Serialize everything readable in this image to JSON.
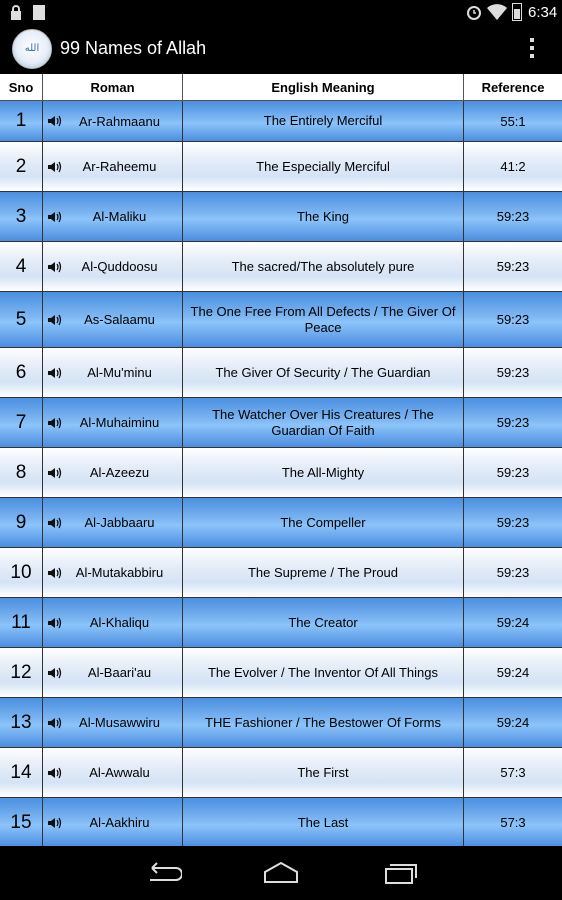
{
  "status_bar": {
    "time": "6:34"
  },
  "app": {
    "title": "99 Names of Allah",
    "icon_text": "الله"
  },
  "table": {
    "headers": {
      "sno": "Sno",
      "roman": "Roman",
      "meaning": "English Meaning",
      "reference": "Reference"
    },
    "rows": [
      {
        "sno": "1",
        "roman": "Ar-Rahmaanu",
        "meaning": "The Entirely Merciful",
        "reference": "55:1"
      },
      {
        "sno": "2",
        "roman": "Ar-Raheemu",
        "meaning": "The Especially Merciful",
        "reference": "41:2"
      },
      {
        "sno": "3",
        "roman": "Al-Maliku",
        "meaning": "The King",
        "reference": "59:23"
      },
      {
        "sno": "4",
        "roman": "Al-Quddoosu",
        "meaning": "The sacred/The absolutely pure",
        "reference": "59:23"
      },
      {
        "sno": "5",
        "roman": "As-Salaamu",
        "meaning": "The One Free From All Defects / The Giver Of Peace",
        "reference": "59:23"
      },
      {
        "sno": "6",
        "roman": "Al-Mu'minu",
        "meaning": "The Giver Of Security / The Guardian",
        "reference": "59:23"
      },
      {
        "sno": "7",
        "roman": "Al-Muhaiminu",
        "meaning": "The Watcher Over His Creatures / The Guardian Of Faith",
        "reference": "59:23"
      },
      {
        "sno": "8",
        "roman": "Al-Azeezu",
        "meaning": "The All-Mighty",
        "reference": "59:23"
      },
      {
        "sno": "9",
        "roman": "Al-Jabbaaru",
        "meaning": "The Compeller",
        "reference": "59:23"
      },
      {
        "sno": "10",
        "roman": "Al-Mutakabbiru",
        "meaning": "The Supreme / The Proud",
        "reference": "59:23"
      },
      {
        "sno": "11",
        "roman": "Al-Khaliqu",
        "meaning": "The Creator",
        "reference": "59:24"
      },
      {
        "sno": "12",
        "roman": "Al-Baari'au",
        "meaning": "The Evolver / The Inventor Of All Things",
        "reference": "59:24"
      },
      {
        "sno": "13",
        "roman": "Al-Musawwiru",
        "meaning": "THE Fashioner / The Bestower Of Forms",
        "reference": "59:24"
      },
      {
        "sno": "14",
        "roman": "Al-Awwalu",
        "meaning": "The First",
        "reference": "57:3"
      },
      {
        "sno": "15",
        "roman": "Al-Aakhiru",
        "meaning": "The Last",
        "reference": "57:3"
      }
    ]
  },
  "nav_bar": {
    "icons": [
      "back-icon",
      "home-icon",
      "recent-apps-icon"
    ]
  }
}
